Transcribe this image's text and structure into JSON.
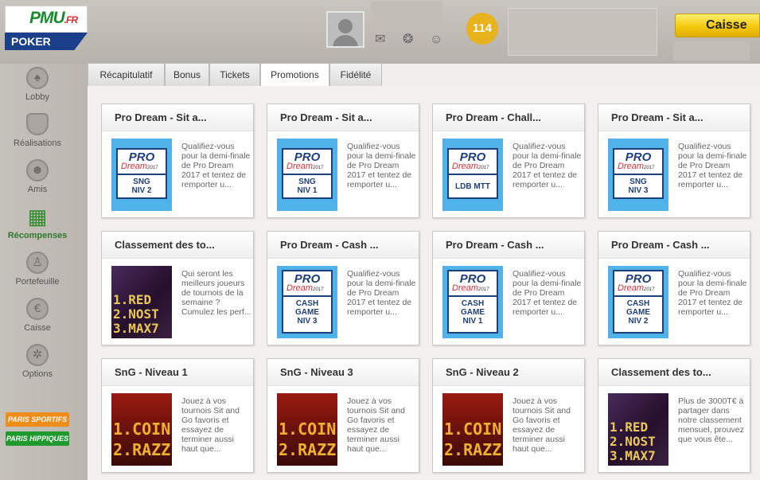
{
  "header": {
    "logo_brand": "PMU",
    "logo_tld": ".FR",
    "logo_product": "POKER",
    "badge_count": "114",
    "caisse_label": "Caisse",
    "icons": [
      "mail-icon",
      "help-icon",
      "friends-icon"
    ]
  },
  "sidebar": {
    "items": [
      {
        "label": "Lobby",
        "icon": "spade-icon"
      },
      {
        "label": "Réalisations",
        "icon": "shield-icon"
      },
      {
        "label": "Amis",
        "icon": "people-icon"
      },
      {
        "label": "Récompenses",
        "icon": "gift-icon",
        "active": true
      },
      {
        "label": "Portefeuille",
        "icon": "person-icon"
      },
      {
        "label": "Caisse",
        "icon": "euro-icon"
      },
      {
        "label": "Options",
        "icon": "wrench-icon"
      }
    ],
    "paris_sportifs": "PARIS SPORTIFS",
    "paris_hippiques": "PARIS HIPPIQUES",
    "colors": {
      "paris_sportifs": "#f08c1a",
      "paris_hippiques": "#1f9a2e"
    }
  },
  "tabs": [
    {
      "label": "Récapitulatif"
    },
    {
      "label": "Bonus"
    },
    {
      "label": "Tickets"
    },
    {
      "label": "Promotions",
      "active": true
    },
    {
      "label": "Fidélité"
    }
  ],
  "cards": [
    {
      "title": "Pro Dream - Sit a...",
      "thumb": {
        "kind": "pro",
        "pro": "PRO",
        "dream": "Dream",
        "year": "2017",
        "sub": [
          "SNG",
          "NIV 2"
        ]
      },
      "desc": "Qualifiez-vous pour la demi-finale de Pro Dream 2017 et tentez de remporter u..."
    },
    {
      "title": "Pro Dream - Sit a...",
      "thumb": {
        "kind": "pro",
        "pro": "PRO",
        "dream": "Dream",
        "year": "2017",
        "sub": [
          "SNG",
          "NIV 1"
        ]
      },
      "desc": "Qualifiez-vous pour la demi-finale de Pro Dream 2017 et tentez de remporter u..."
    },
    {
      "title": "Pro Dream - Chall...",
      "thumb": {
        "kind": "pro",
        "pro": "PRO",
        "dream": "Dream",
        "year": "2017",
        "sub": [
          "LDB MTT"
        ]
      },
      "desc": "Qualifiez-vous pour la demi-finale de Pro Dream 2017 et tentez de remporter u..."
    },
    {
      "title": "Pro Dream - Sit a...",
      "thumb": {
        "kind": "pro",
        "pro": "PRO",
        "dream": "Dream",
        "year": "2017",
        "sub": [
          "SNG",
          "NIV 3"
        ]
      },
      "desc": "Qualifiez-vous pour la demi-finale de Pro Dream 2017 et tentez de remporter u..."
    },
    {
      "title": "Classement des to...",
      "thumb": {
        "kind": "led",
        "tone": "purple",
        "lines": [
          "1.RED",
          "2.NOST",
          "3.MAX7"
        ]
      },
      "desc": "Qui seront les meilleurs joueurs de tournois de la semaine ? Cumulez les perf..."
    },
    {
      "title": "Pro Dream - Cash ...",
      "thumb": {
        "kind": "pro-cash",
        "pro": "PRO",
        "dream": "Dream",
        "year": "2017",
        "sub": [
          "CASH",
          "GAME",
          "NIV 3"
        ]
      },
      "desc": "Qualifiez-vous pour la demi-finale de Pro Dream 2017 et tentez de remporter u..."
    },
    {
      "title": "Pro Dream - Cash ...",
      "thumb": {
        "kind": "pro-cash",
        "pro": "PRO",
        "dream": "Dream",
        "year": "2017",
        "sub": [
          "CASH",
          "GAME",
          "NIV 1"
        ]
      },
      "desc": "Qualifiez-vous pour la demi-finale de Pro Dream 2017 et tentez de remporter u..."
    },
    {
      "title": "Pro Dream - Cash ...",
      "thumb": {
        "kind": "pro-cash",
        "pro": "PRO",
        "dream": "Dream",
        "year": "2017",
        "sub": [
          "CASH",
          "GAME",
          "NIV 2"
        ]
      },
      "desc": "Qualifiez-vous pour la demi-finale de Pro Dream 2017 et tentez de remporter u..."
    },
    {
      "title": "SnG - Niveau 1",
      "thumb": {
        "kind": "led",
        "tone": "red",
        "lines": [
          "1.COIN",
          "2.RAZZ"
        ]
      },
      "desc": "Jouez à vos tournois Sit and Go favoris et essayez de terminer aussi haut que..."
    },
    {
      "title": "SnG - Niveau 3",
      "thumb": {
        "kind": "led",
        "tone": "red",
        "lines": [
          "1.COIN",
          "2.RAZZ"
        ]
      },
      "desc": "Jouez à vos tournois Sit and Go favoris et essayez de terminer aussi haut que..."
    },
    {
      "title": "SnG - Niveau 2",
      "thumb": {
        "kind": "led",
        "tone": "red",
        "lines": [
          "1.COIN",
          "2.RAZZ"
        ]
      },
      "desc": "Jouez à vos tournois Sit and Go favoris et essayez de terminer aussi haut que..."
    },
    {
      "title": "Classement des to...",
      "thumb": {
        "kind": "led",
        "tone": "purple",
        "lines": [
          "1.RED",
          "2.NOST",
          "3.MAX7"
        ]
      },
      "desc": "Plus de 3000T€ à partager dans notre classement mensuel, prouvez que vous ête..."
    }
  ]
}
